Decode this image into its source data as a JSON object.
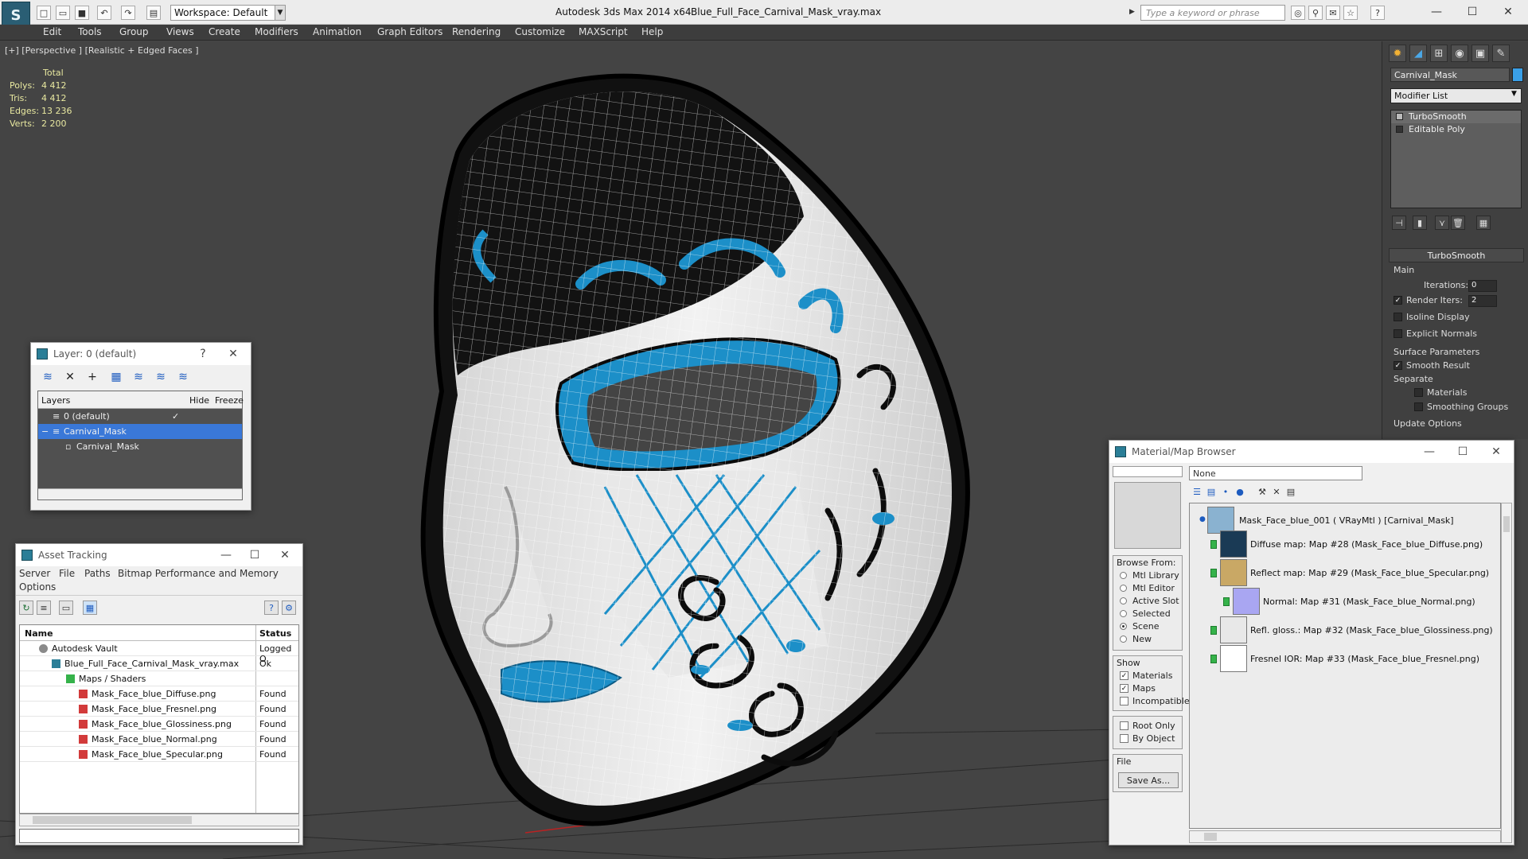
{
  "titlebar": {
    "workspace": "Workspace: Default",
    "app_title": "Autodesk 3ds Max  2014 x64",
    "doc_title": "Blue_Full_Face_Carnival_Mask_vray.max",
    "search_placeholder": "Type a keyword or phrase"
  },
  "menu": [
    "Edit",
    "Tools",
    "Group",
    "Views",
    "Create",
    "Modifiers",
    "Animation",
    "Graph Editors",
    "Rendering",
    "Customize",
    "MAXScript",
    "Help"
  ],
  "viewport": {
    "label": "[+] [Perspective ] [Realistic + Edged Faces ]",
    "stats": {
      "header": "Total",
      "rows": [
        {
          "label": "Polys:",
          "value": "4 412"
        },
        {
          "label": "Tris:",
          "value": "4 412"
        },
        {
          "label": "Edges:",
          "value": "13 236"
        },
        {
          "label": "Verts:",
          "value": "2 200"
        }
      ]
    }
  },
  "command_panel": {
    "object_name": "Carnival_Mask",
    "object_color": "#3aa0e8",
    "modifier_list": "Modifier List",
    "stack": [
      "TurboSmooth",
      "Editable Poly"
    ],
    "rollout_title": "TurboSmooth",
    "main_label": "Main",
    "iterations_label": "Iterations:",
    "iterations_value": "0",
    "render_iters_label": "Render Iters:",
    "render_iters_value": "2",
    "isoline_label": "Isoline Display",
    "explicit_normals_label": "Explicit Normals",
    "surface_params_label": "Surface Parameters",
    "smooth_result_label": "Smooth Result",
    "separate_label": "Separate",
    "materials_label": "Materials",
    "smoothing_groups_label": "Smoothing Groups",
    "update_options_label": "Update Options"
  },
  "layer_window": {
    "title": "Layer: 0 (default)",
    "help": "?",
    "columns": [
      "Layers",
      "Hide",
      "Freeze"
    ],
    "rows": [
      "0 (default)",
      "Carnival_Mask",
      "Carnival_Mask"
    ]
  },
  "asset_window": {
    "title": "Asset Tracking",
    "menu": [
      "Server",
      "File",
      "Paths",
      "Bitmap Performance and Memory",
      "Options"
    ],
    "columns": [
      "Name",
      "Status"
    ],
    "rows": [
      {
        "name": "Autodesk Vault",
        "status": "Logged O",
        "indent": 0
      },
      {
        "name": "Blue_Full_Face_Carnival_Mask_vray.max",
        "status": "Ok",
        "indent": 1
      },
      {
        "name": "Maps / Shaders",
        "status": "",
        "indent": 2
      },
      {
        "name": "Mask_Face_blue_Diffuse.png",
        "status": "Found",
        "indent": 3
      },
      {
        "name": "Mask_Face_blue_Fresnel.png",
        "status": "Found",
        "indent": 3
      },
      {
        "name": "Mask_Face_blue_Glossiness.png",
        "status": "Found",
        "indent": 3
      },
      {
        "name": "Mask_Face_blue_Normal.png",
        "status": "Found",
        "indent": 3
      },
      {
        "name": "Mask_Face_blue_Specular.png",
        "status": "Found",
        "indent": 3
      }
    ]
  },
  "material_window": {
    "title": "Material/Map Browser",
    "search_value": "None",
    "browse_from_title": "Browse From:",
    "browse_from": [
      "Mtl Library",
      "Mtl Editor",
      "Active Slot",
      "Selected",
      "Scene",
      "New"
    ],
    "show_title": "Show",
    "show": [
      "Materials",
      "Maps",
      "Incompatible"
    ],
    "extra": [
      "Root Only",
      "By Object"
    ],
    "file_title": "File",
    "save_as": "Save As...",
    "tree": [
      "Mask_Face_blue_001  ( VRayMtl )  [Carnival_Mask]",
      "Diffuse map: Map #28 (Mask_Face_blue_Diffuse.png)",
      "Reflect map: Map #29 (Mask_Face_blue_Specular.png)",
      "Normal: Map #31 (Mask_Face_blue_Normal.png)",
      "Refl. gloss.: Map #32 (Mask_Face_blue_Glossiness.png)",
      "Fresnel IOR: Map #33 (Mask_Face_blue_Fresnel.png)"
    ]
  }
}
